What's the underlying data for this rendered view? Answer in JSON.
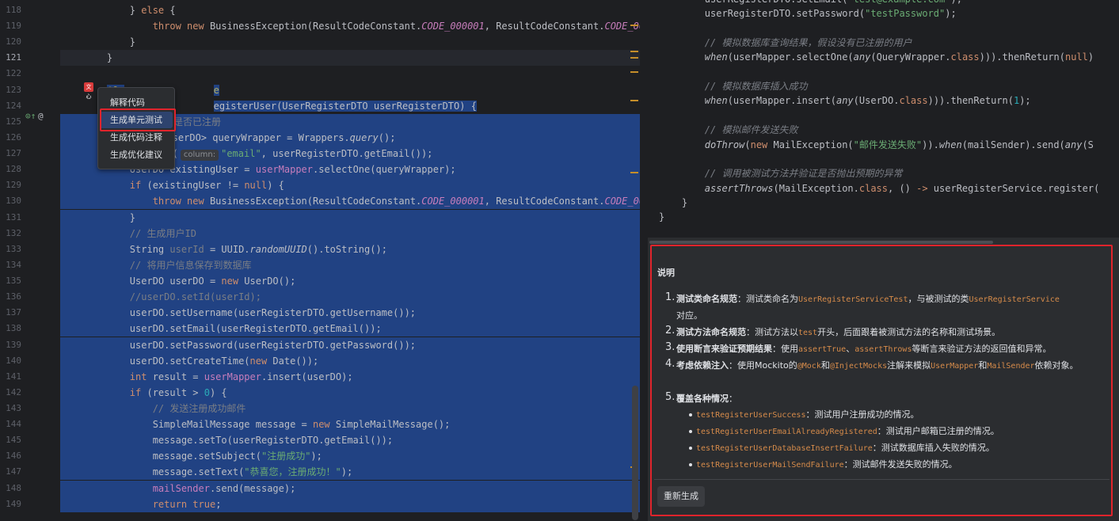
{
  "editor": {
    "lines": [
      {
        "n": "118",
        "tokens": [
          [
            "pl",
            "        } "
          ],
          [
            "kw",
            "else"
          ],
          [
            "pl",
            " {"
          ]
        ]
      },
      {
        "n": "119",
        "tokens": [
          [
            "pl",
            "            "
          ],
          [
            "kw",
            "throw new "
          ],
          [
            "pl",
            "BusinessException(ResultCodeConstant."
          ],
          [
            "cst",
            "CODE_000001"
          ],
          [
            "pl",
            ", ResultCodeConstant."
          ],
          [
            "cst",
            "CODE_0000"
          ]
        ]
      },
      {
        "n": "120",
        "tokens": [
          [
            "pl",
            "        }"
          ]
        ]
      },
      {
        "n": "121",
        "cur": true,
        "tokens": [
          [
            "pl",
            "    }"
          ]
        ]
      },
      {
        "n": "122",
        "tokens": []
      },
      {
        "n": "123",
        "partial": true,
        "tokens": [
          [
            "pl",
            "    "
          ]
        ]
      },
      {
        "n": "124",
        "partial": true,
        "tokens": [
          [
            "pl",
            "    "
          ]
        ]
      },
      {
        "n": "125",
        "sel": true,
        "tokens": []
      },
      {
        "n": "126",
        "sel": true,
        "tokens": []
      },
      {
        "n": "127",
        "sel": true,
        "tokens": []
      },
      {
        "n": "128",
        "sel": true,
        "tokens": [
          [
            "pl",
            "        UserDO existingUser = "
          ],
          [
            "fld",
            "userMapper"
          ],
          [
            "pl",
            ".selectOne(queryWrapper);"
          ]
        ]
      },
      {
        "n": "129",
        "sel": true,
        "tokens": [
          [
            "pl",
            "        "
          ],
          [
            "kw",
            "if "
          ],
          [
            "pl",
            "(existingUser != "
          ],
          [
            "kw",
            "null"
          ],
          [
            "pl",
            ") {"
          ]
        ]
      },
      {
        "n": "130",
        "sel": true,
        "tokens": [
          [
            "pl",
            "            "
          ],
          [
            "kw",
            "throw new "
          ],
          [
            "pl",
            "BusinessException(ResultCodeConstant."
          ],
          [
            "cst",
            "CODE_000001"
          ],
          [
            "pl",
            ", ResultCodeConstant."
          ],
          [
            "cst",
            "CODE_0000"
          ]
        ]
      },
      {
        "n": "131",
        "sel": true,
        "tokens": [
          [
            "pl",
            "        }"
          ]
        ]
      },
      {
        "n": "132",
        "sel": true,
        "tokens": [
          [
            "pl",
            "        "
          ],
          [
            "cm",
            "// 生成用户ID"
          ]
        ]
      },
      {
        "n": "133",
        "sel": true,
        "tokens": [
          [
            "pl",
            "        String "
          ],
          [
            "gray",
            "userId"
          ],
          [
            "pl",
            " = UUID."
          ],
          [
            "it",
            "randomUUID"
          ],
          [
            "pl",
            "().toString();"
          ]
        ]
      },
      {
        "n": "134",
        "sel": true,
        "tokens": [
          [
            "pl",
            "        "
          ],
          [
            "cm",
            "// 将用户信息保存到数据库"
          ]
        ]
      },
      {
        "n": "135",
        "sel": true,
        "tokens": [
          [
            "pl",
            "        UserDO userDO = "
          ],
          [
            "kw",
            "new "
          ],
          [
            "pl",
            "UserDO();"
          ]
        ]
      },
      {
        "n": "136",
        "sel": true,
        "tokens": [
          [
            "pl",
            "        "
          ],
          [
            "cm",
            "//userDO.setId(userId);"
          ]
        ]
      },
      {
        "n": "137",
        "sel": true,
        "tokens": [
          [
            "pl",
            "        userDO.setUsername(userRegisterDTO.getUsername());"
          ]
        ]
      },
      {
        "n": "138",
        "sel": true,
        "tokens": [
          [
            "pl",
            "        userDO.setEmail(userRegisterDTO.getEmail());"
          ]
        ]
      },
      {
        "n": "139",
        "sel": true,
        "tokens": [
          [
            "pl",
            "        userDO.setPassword(userRegisterDTO.getPassword());"
          ]
        ]
      },
      {
        "n": "140",
        "sel": true,
        "tokens": [
          [
            "pl",
            "        userDO.setCreateTime("
          ],
          [
            "kw",
            "new "
          ],
          [
            "pl",
            "Date());"
          ]
        ]
      },
      {
        "n": "141",
        "sel": true,
        "tokens": [
          [
            "pl",
            "        "
          ],
          [
            "kw",
            "int "
          ],
          [
            "pl",
            "result = "
          ],
          [
            "fld",
            "userMapper"
          ],
          [
            "pl",
            ".insert(userDO);"
          ]
        ]
      },
      {
        "n": "142",
        "sel": true,
        "tokens": [
          [
            "pl",
            "        "
          ],
          [
            "kw",
            "if "
          ],
          [
            "pl",
            "(result > "
          ],
          [
            "num",
            "0"
          ],
          [
            "pl",
            ") {"
          ]
        ]
      },
      {
        "n": "143",
        "sel": true,
        "tokens": [
          [
            "pl",
            "            "
          ],
          [
            "cm",
            "// 发送注册成功邮件"
          ]
        ]
      },
      {
        "n": "144",
        "sel": true,
        "tokens": [
          [
            "pl",
            "            SimpleMailMessage message = "
          ],
          [
            "kw",
            "new "
          ],
          [
            "pl",
            "SimpleMailMessage();"
          ]
        ]
      },
      {
        "n": "145",
        "sel": true,
        "tokens": [
          [
            "pl",
            "            message.setTo(userRegisterDTO.getEmail());"
          ]
        ]
      },
      {
        "n": "146",
        "sel": true,
        "tokens": [
          [
            "pl",
            "            message.setSubject("
          ],
          [
            "str",
            "\"注册成功\""
          ],
          [
            "pl",
            ");"
          ]
        ]
      },
      {
        "n": "147",
        "sel": true,
        "tokens": [
          [
            "pl",
            "            message.setText("
          ],
          [
            "str",
            "\"恭喜您，注册成功！\""
          ],
          [
            "pl",
            ");"
          ]
        ]
      },
      {
        "n": "148",
        "sel": true,
        "tokens": [
          [
            "pl",
            "            "
          ],
          [
            "fld",
            "mailSender"
          ],
          [
            "pl",
            ".send(message);"
          ]
        ]
      },
      {
        "n": "149",
        "sel": true,
        "tokens": [
          [
            "pl",
            "            "
          ],
          [
            "kw",
            "return true"
          ],
          [
            "pl",
            ";"
          ]
        ]
      }
    ],
    "line123_visible": "@Ov",
    "line123_tail": "e",
    "line124_visible": "pul",
    "line124_tail": "egisterUser(UserRegisterDTO userRegisterDTO) {",
    "line125_tail": "是否已注册",
    "line126_tail": "r<UserDO> queryWrapper = Wrappers.",
    "line126_query": "query",
    "line126_end": "();",
    "line127_pre": ".eq(",
    "line127_hint": "column:",
    "line127_str": "\"email\"",
    "line127_end": ", userRegisterDTO.getEmail());",
    "ai_tag": "文心",
    "gutter_icons": "⊙↑",
    "gutter_at": "@"
  },
  "context_menu": {
    "items": [
      "解释代码",
      "生成单元测试",
      "生成代码注释",
      "生成优化建议"
    ],
    "highlighted": "生成单元测试"
  },
  "right_code": {
    "lines": [
      [
        [
          "pl",
          "        userRegisterDTO.setEmail("
        ],
        [
          "str",
          "\"test@example.com\""
        ],
        [
          "pl",
          ");"
        ]
      ],
      [
        [
          "pl",
          "        userRegisterDTO.setPassword("
        ],
        [
          "str",
          "\"testPassword\""
        ],
        [
          "pl",
          ");"
        ]
      ],
      [],
      [
        [
          "pl",
          "        "
        ],
        [
          "cmi",
          "// 模拟数据库查询结果，假设没有已注册的用户"
        ]
      ],
      [
        [
          "pl",
          "        "
        ],
        [
          "it",
          "when"
        ],
        [
          "pl",
          "(userMapper.selectOne("
        ],
        [
          "it",
          "any"
        ],
        [
          "pl",
          "(QueryWrapper."
        ],
        [
          "kw",
          "class"
        ],
        [
          "pl",
          "))).thenReturn("
        ],
        [
          "kw",
          "null"
        ],
        [
          "pl",
          ")"
        ]
      ],
      [],
      [
        [
          "pl",
          "        "
        ],
        [
          "cmi",
          "// 模拟数据库插入成功"
        ]
      ],
      [
        [
          "pl",
          "        "
        ],
        [
          "it",
          "when"
        ],
        [
          "pl",
          "(userMapper.insert("
        ],
        [
          "it",
          "any"
        ],
        [
          "pl",
          "(UserDO."
        ],
        [
          "kw",
          "class"
        ],
        [
          "pl",
          "))).thenReturn("
        ],
        [
          "num",
          "1"
        ],
        [
          "pl",
          ");"
        ]
      ],
      [],
      [
        [
          "pl",
          "        "
        ],
        [
          "cmi",
          "// 模拟邮件发送失败"
        ]
      ],
      [
        [
          "pl",
          "        "
        ],
        [
          "it",
          "doThrow"
        ],
        [
          "pl",
          "("
        ],
        [
          "kw",
          "new "
        ],
        [
          "pl",
          "MailException("
        ],
        [
          "str",
          "\"邮件发送失败\""
        ],
        [
          "pl",
          "))."
        ],
        [
          "it",
          "when"
        ],
        [
          "pl",
          "(mailSender).send("
        ],
        [
          "it",
          "any"
        ],
        [
          "pl",
          "(S"
        ]
      ],
      [],
      [
        [
          "pl",
          "        "
        ],
        [
          "cmi",
          "// 调用被测试方法并验证是否抛出预期的异常"
        ]
      ],
      [
        [
          "pl",
          "        "
        ],
        [
          "it",
          "assertThrows"
        ],
        [
          "pl",
          "(MailException."
        ],
        [
          "kw",
          "class"
        ],
        [
          "pl",
          ", () "
        ],
        [
          "kw",
          "->"
        ],
        [
          "pl",
          " userRegisterService.register("
        ]
      ],
      [
        [
          "pl",
          "    }"
        ]
      ],
      [
        [
          "pl",
          "}"
        ]
      ]
    ]
  },
  "explanation": {
    "title": "说明",
    "items": [
      {
        "num": "1.",
        "label": "测试类命名规范",
        "text1": "：测试类命名为",
        "code1": "UserRegisterServiceTest",
        "text2": "，与被测试的类",
        "code2": "UserRegisterService",
        "text3": "对应。"
      },
      {
        "num": "2.",
        "label": "测试方法命名规范",
        "text1": "：测试方法以",
        "code1": "test",
        "text2": "开头，后面跟着被测试方法的名称和测试场景。"
      },
      {
        "num": "3.",
        "label": "使用断言来验证预期结果",
        "text1": "：使用",
        "code1": "assertTrue",
        "text2": "、",
        "code2": "assertThrows",
        "text3": "等断言来验证方法的返回值和异常。"
      },
      {
        "num": "4.",
        "label": "考虑依赖注入",
        "text1": "：使用Mockito的",
        "code1": "@Mock",
        "text2": "和",
        "code2": "@InjectMocks",
        "text3": "注解来模拟",
        "code3": "UserMapper",
        "text4": "和",
        "code4": "MailSender",
        "text5": "依赖对象。"
      },
      {
        "num": "5.",
        "label": "覆盖各种情况",
        "text1": "："
      }
    ],
    "bullets": [
      {
        "code": "testRegisterUserSuccess",
        "text": "：测试用户注册成功的情况。"
      },
      {
        "code": "testRegisterUserEmailAlreadyRegistered",
        "text": "：测试用户邮箱已注册的情况。"
      },
      {
        "code": "testRegisterUserDatabaseInsertFailure",
        "text": "：测试数据库插入失败的情况。"
      },
      {
        "code": "testRegisterUserMailSendFailure",
        "text": "：测试邮件发送失败的情况。"
      }
    ],
    "regenerate_label": "重新生成"
  },
  "colors": {
    "selection": "#214283",
    "keyword": "#cf8e6d",
    "string": "#6aab73",
    "field": "#c77dbb",
    "comment": "#7a7e85",
    "highlight_box": "#e0242c",
    "inline_code": "#d68b4a"
  }
}
